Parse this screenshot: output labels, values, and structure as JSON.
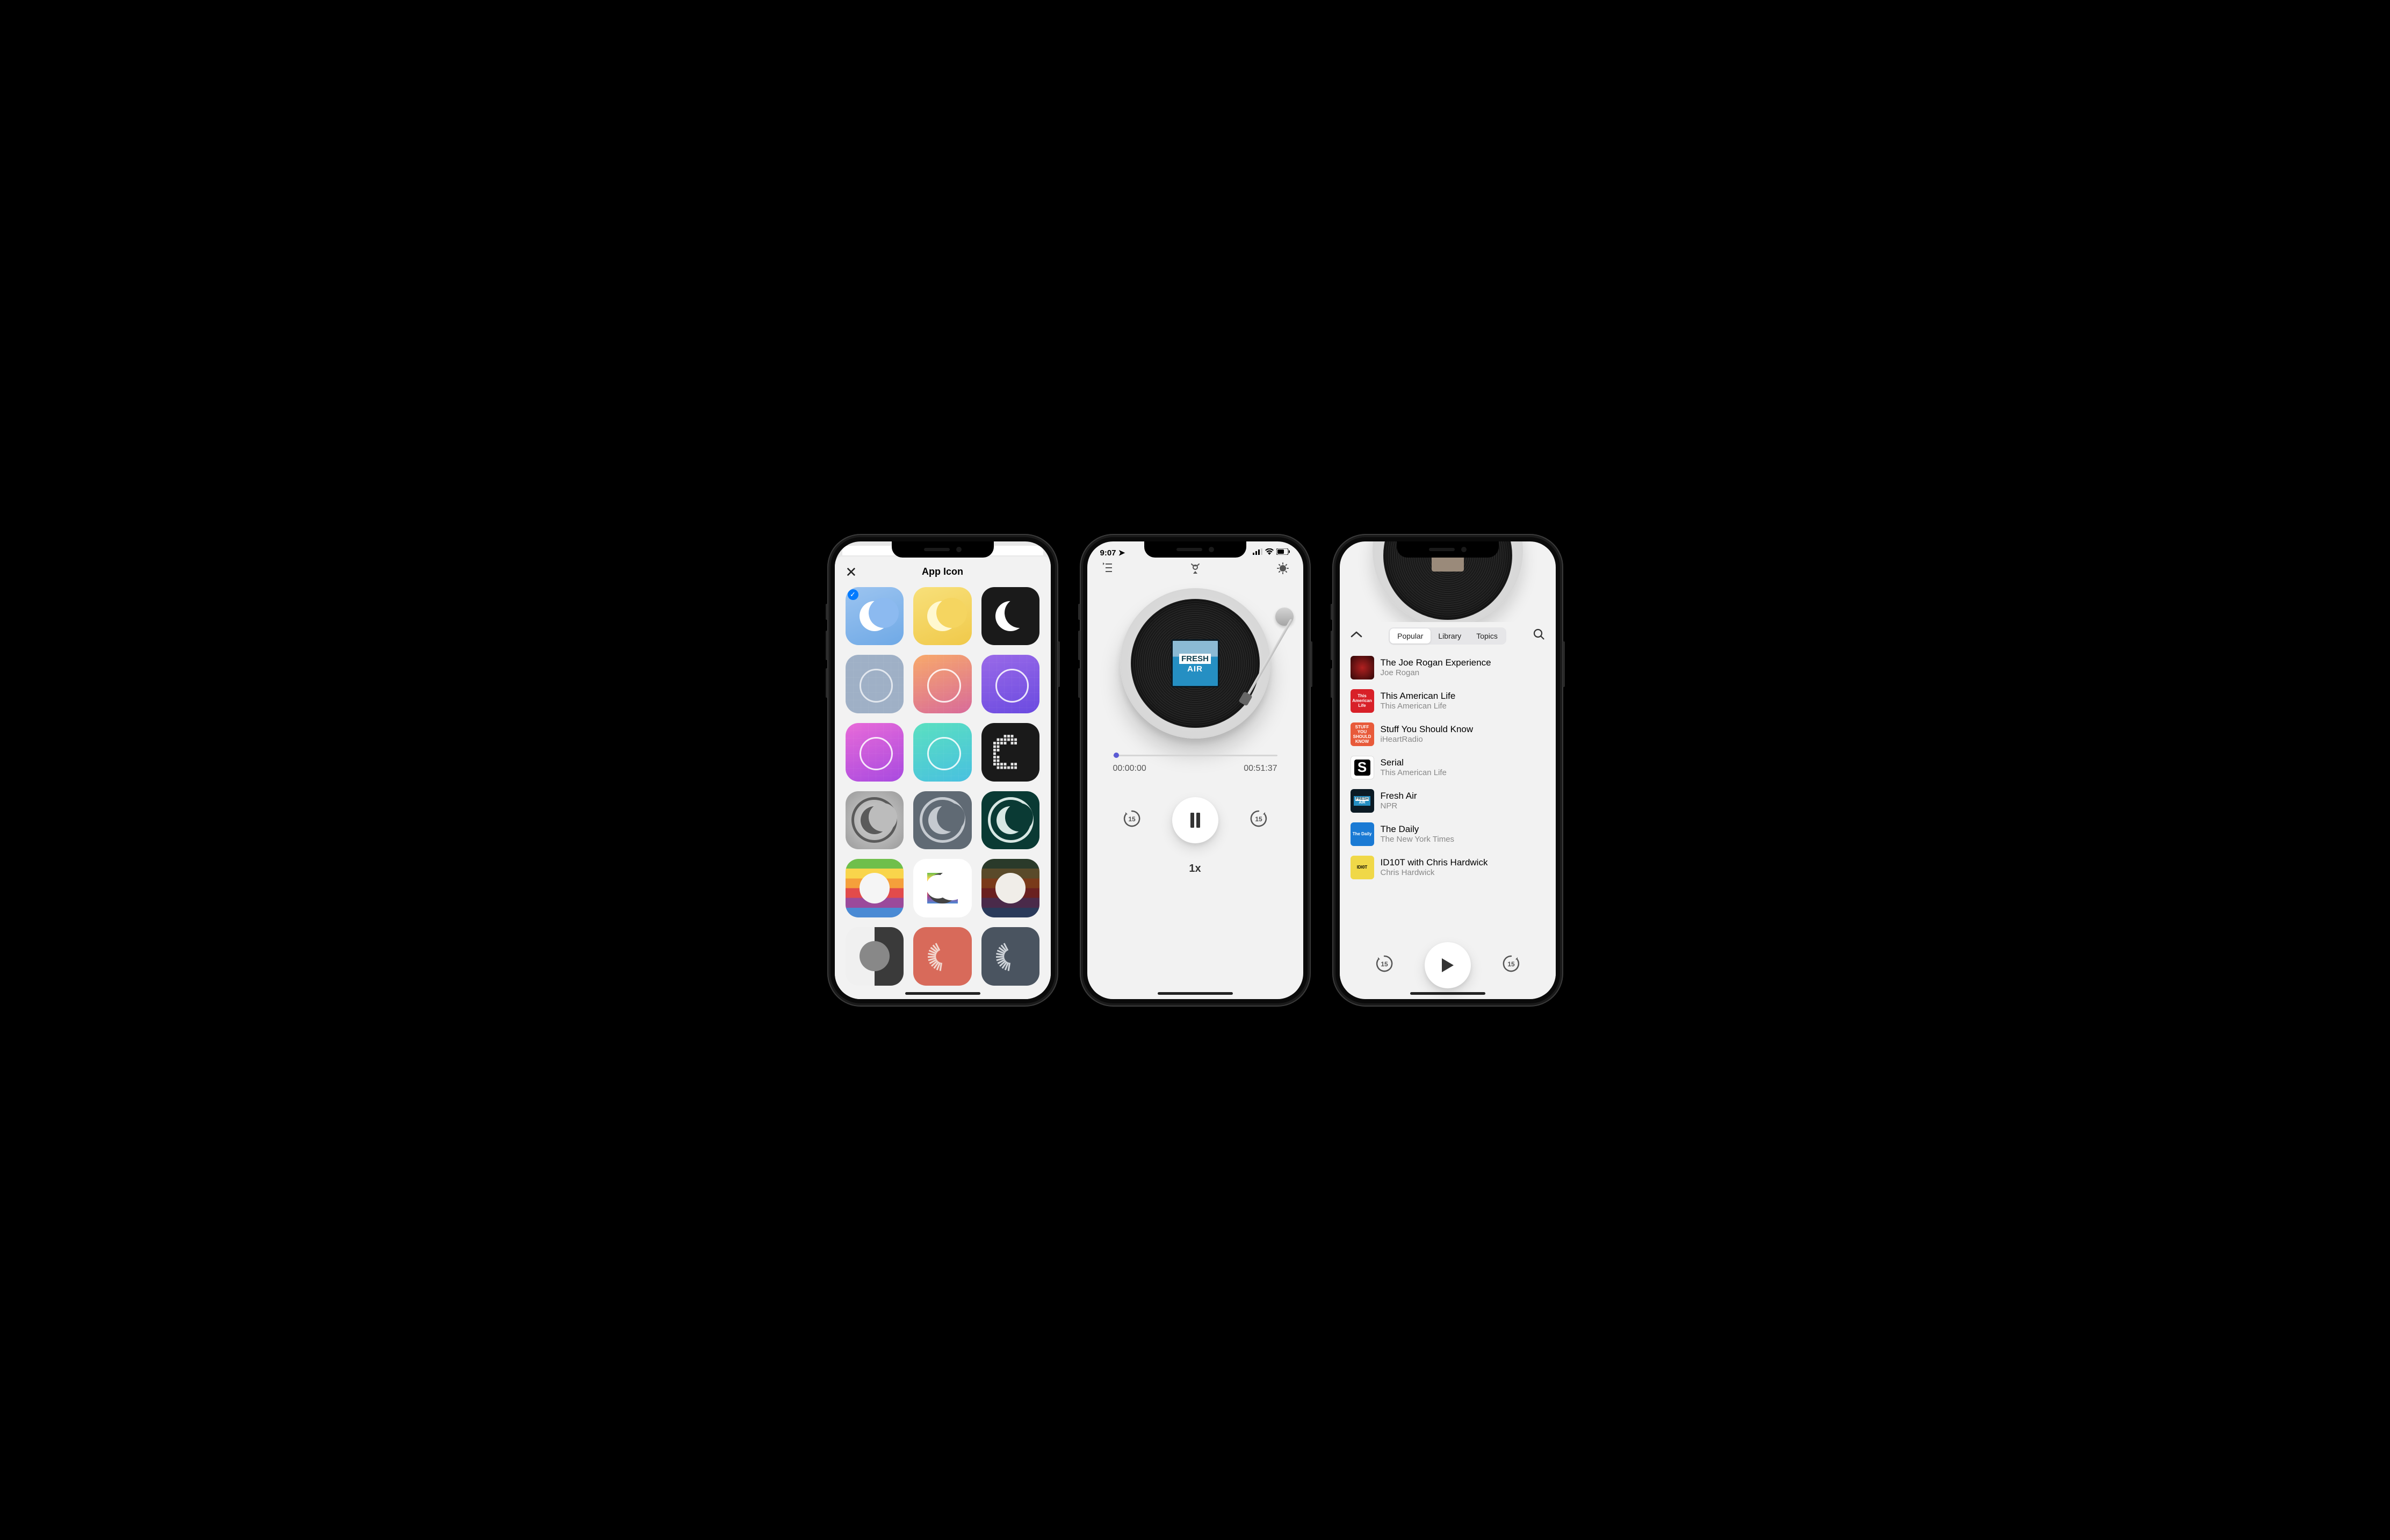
{
  "screen1": {
    "title": "App Icon",
    "icons": [
      {
        "name": "soft-blue",
        "bg": "linear-gradient(160deg,#9cc4f0,#6fa9e6)",
        "moon": "#ffffff",
        "mask": "#8cbaf0",
        "checked": true
      },
      {
        "name": "yellow",
        "bg": "linear-gradient(160deg,#f8e07a,#f0c94a)",
        "moon": "#fff8d0",
        "mask": "#f5d560"
      },
      {
        "name": "black",
        "bg": "#1a1a1a",
        "moon": "#ffffff",
        "mask": "#1a1a1a"
      },
      {
        "name": "outline-gray",
        "bg": "#9fb0c6",
        "moon": "rgba(255,255,255,.7)",
        "outline": true,
        "grid": true
      },
      {
        "name": "outline-sunset",
        "bg": "linear-gradient(160deg,#f8a96a,#d86a9a)",
        "moon": "rgba(255,255,255,.85)",
        "outline": true,
        "grid": true
      },
      {
        "name": "outline-purple",
        "bg": "linear-gradient(160deg,#9a6ae8,#6a4ae0)",
        "moon": "rgba(255,255,255,.85)",
        "outline": true,
        "grid": true
      },
      {
        "name": "outline-magenta",
        "bg": "linear-gradient(160deg,#e86ad8,#a84ae0)",
        "moon": "rgba(255,255,255,.85)",
        "outline": true,
        "grid": true
      },
      {
        "name": "outline-teal",
        "bg": "linear-gradient(160deg,#5ae0c0,#48c0e0)",
        "moon": "rgba(255,255,255,.85)",
        "outline": true,
        "grid": true
      },
      {
        "name": "pixel-black",
        "bg": "#1a1a1a",
        "moon": "#e5e5e5",
        "pixel": true
      },
      {
        "name": "ring-gray",
        "bg": "radial-gradient(circle,#d5d5d5,#9a9a9a)",
        "moon": "#5a5a5a",
        "ring": true,
        "mask": "#bcbcbc"
      },
      {
        "name": "ring-slate",
        "bg": "#606a74",
        "moon": "#c5cad0",
        "ring": true,
        "mask": "#606a74"
      },
      {
        "name": "ring-teal",
        "bg": "#0a3a34",
        "moon": "#d8e8e4",
        "ring": true,
        "mask": "#0a3a34"
      },
      {
        "name": "rainbow-light",
        "rainbow": "light",
        "moon": "#f5f5f5"
      },
      {
        "name": "rainbow-white",
        "bg": "#ffffff",
        "moon": "#444",
        "rainbowMoon": true,
        "mask": "#ffffff"
      },
      {
        "name": "rainbow-dark",
        "rainbow": "dark",
        "moon": "#f0ede8"
      },
      {
        "name": "split-gray",
        "bg": "linear-gradient(90deg,#f0f0f0 50%,#3a3a3a 50%)",
        "moon": "#888",
        "mask": "transparent"
      },
      {
        "name": "striped-red",
        "bg": "#d86a5a",
        "moon": "#f2d8d0",
        "stripes": true,
        "mask": "#d86a5a"
      },
      {
        "name": "striped-slate",
        "bg": "#4a5460",
        "moon": "#d0d5da",
        "stripes": true,
        "mask": "#4a5460"
      }
    ]
  },
  "screen2": {
    "status_time": "9:07",
    "vinyl_label_top": "FRESH",
    "vinyl_label_bottom": "AIR",
    "time_elapsed": "00:00:00",
    "time_total": "00:51:37",
    "skip_back": "15",
    "skip_fwd": "15",
    "speed": "1x"
  },
  "screen3": {
    "tabs": [
      "Popular",
      "Library",
      "Topics"
    ],
    "active_tab": 0,
    "podcasts": [
      {
        "title": "The Joe Rogan Experience",
        "sub": "Joe Rogan",
        "art_bg": "radial-gradient(circle,#b02020,#300808)",
        "art_text": ""
      },
      {
        "title": "This American Life",
        "sub": "This American Life",
        "art_bg": "#d82028",
        "art_text": "This American Life"
      },
      {
        "title": "Stuff You Should Know",
        "sub": "iHeartRadio",
        "art_bg": "#e85a3a",
        "art_text": "STUFF YOU SHOULD KNOW"
      },
      {
        "title": "Serial",
        "sub": "This American Life",
        "art_bg": "#fff",
        "art_text": "S",
        "dark_text": true
      },
      {
        "title": "Fresh Air",
        "sub": "NPR",
        "art_bg": "#0b1a24",
        "art_text": "FRESH AIR",
        "fresh": true
      },
      {
        "title": "The Daily",
        "sub": "The New York Times",
        "art_bg": "#1a7ad4",
        "art_text": "The Daily"
      },
      {
        "title": "ID10T with Chris Hardwick",
        "sub": "Chris Hardwick",
        "art_bg": "#f0d848",
        "art_text": "IDI0T",
        "dark_text": true
      }
    ],
    "skip_back": "15",
    "skip_fwd": "15"
  }
}
